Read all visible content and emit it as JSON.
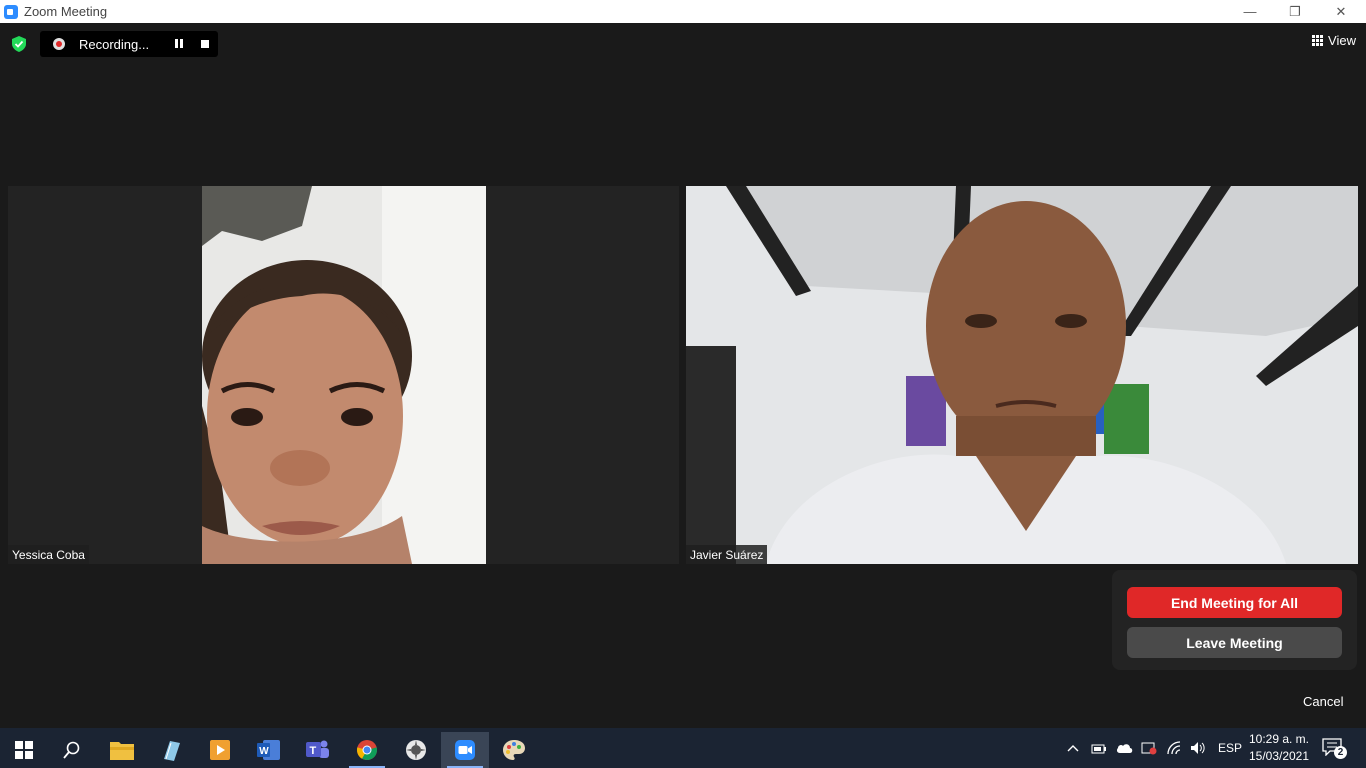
{
  "window": {
    "title": "Zoom Meeting",
    "minimize": "—",
    "restore": "❐",
    "close": "✕"
  },
  "toolbar": {
    "recording_label": "Recording...",
    "view_label": "View"
  },
  "participants": [
    {
      "name": "Yessica Coba"
    },
    {
      "name": "Javier Suárez"
    }
  ],
  "end_dialog": {
    "end_all_label": "End Meeting for All",
    "leave_label": "Leave Meeting",
    "cancel_label": "Cancel"
  },
  "taskbar": {
    "language": "ESP",
    "time": "10:29 a. m.",
    "date": "15/03/2021",
    "notification_count": "2",
    "apps": [
      "windows-start",
      "search",
      "file-explorer",
      "notes",
      "media-player",
      "word",
      "teams",
      "chrome",
      "settings-app",
      "zoom",
      "paint"
    ]
  },
  "colors": {
    "end_all": "#e02828",
    "leave": "#4a4a4a",
    "shield": "#23d959",
    "taskbar": "#1b2433",
    "zoom_blue": "#2d8cff"
  }
}
